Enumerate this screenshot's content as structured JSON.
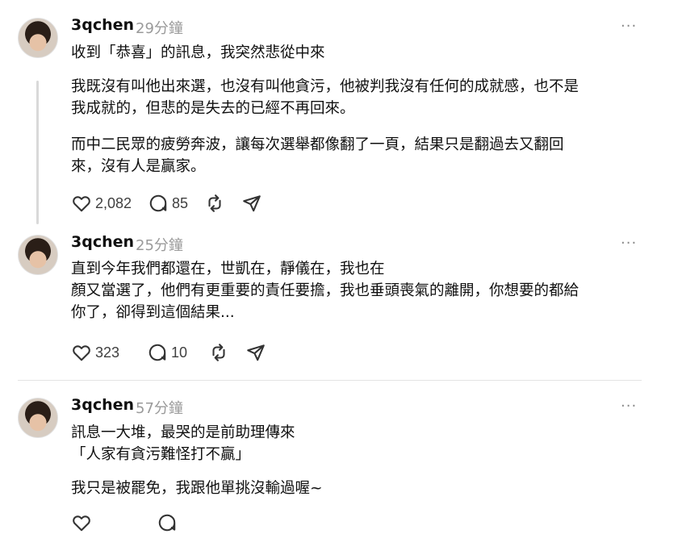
{
  "posts": [
    {
      "username": "3qchen",
      "time": "29分鐘",
      "more": "···",
      "paragraphs": [
        "收到「恭喜」的訊息，我突然悲從中來",
        "我既沒有叫他出來選，也沒有叫他貪污，他被判我沒有任何的成就感，也不是\n我成就的，但悲的是失去的已經不再回來。",
        "而中二民眾的疲勞奔波，讓每次選舉都像翻了一頁，結果只是翻過去又翻回\n來，沒有人是贏家。"
      ],
      "likes": "2,082",
      "replies": "85"
    },
    {
      "username": "3qchen",
      "time": "25分鐘",
      "more": "···",
      "paragraphs": [
        "直到今年我們都還在，世凱在，靜儀在，我也在\n顏又當選了，他們有更重要的責任要擔，我也垂頭喪氣的離開，你想要的都給\n你了，卻得到這個結果..."
      ],
      "likes": "323",
      "replies": "10"
    },
    {
      "username": "3qchen",
      "time": "57分鐘",
      "more": "···",
      "paragraphs": [
        "訊息一大堆，最哭的是前助理傳來\n「人家有貪污難怪打不贏」",
        "我只是被罷免，我跟他單挑沒輸過喔~"
      ]
    }
  ],
  "icons": {
    "like": "heart-icon",
    "reply": "comment-icon",
    "repost": "repost-icon",
    "share": "send-icon",
    "more": "more-icon"
  }
}
